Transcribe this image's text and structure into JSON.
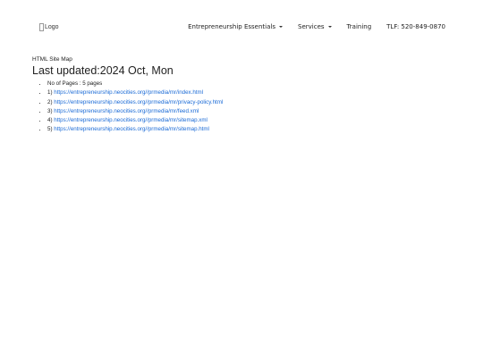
{
  "header": {
    "logo_alt": "Logo",
    "nav": [
      {
        "label": "Entrepreneurship Essentials",
        "dropdown": true
      },
      {
        "label": "Services",
        "dropdown": true
      },
      {
        "label": "Training",
        "dropdown": false
      },
      {
        "label": "TLF: 520-849-0870",
        "dropdown": false
      }
    ]
  },
  "main": {
    "small_title": "HTML Site Map",
    "heading": "Last updated:2024 Oct, Mon",
    "count_label": "No of Pages : 5 pages",
    "links": [
      {
        "prefix": "1)",
        "url": "https://entrepreneurship.neocities.org//prmedia/mr/index.html"
      },
      {
        "prefix": "2)",
        "url": "https://entrepreneurship.neocities.org//prmedia/mr/privacy-policy.html"
      },
      {
        "prefix": "3)",
        "url": "https://entrepreneurship.neocities.org//prmedia/mr/feed.xml"
      },
      {
        "prefix": "4)",
        "url": "https://entrepreneurship.neocities.org//prmedia/mr/sitemap.xml"
      },
      {
        "prefix": "5)",
        "url": "https://entrepreneurship.neocities.org//prmedia/mr/sitemap.html"
      }
    ]
  },
  "colors": {
    "link": "#1a6ad6",
    "text": "#222222",
    "background": "#ffffff"
  }
}
